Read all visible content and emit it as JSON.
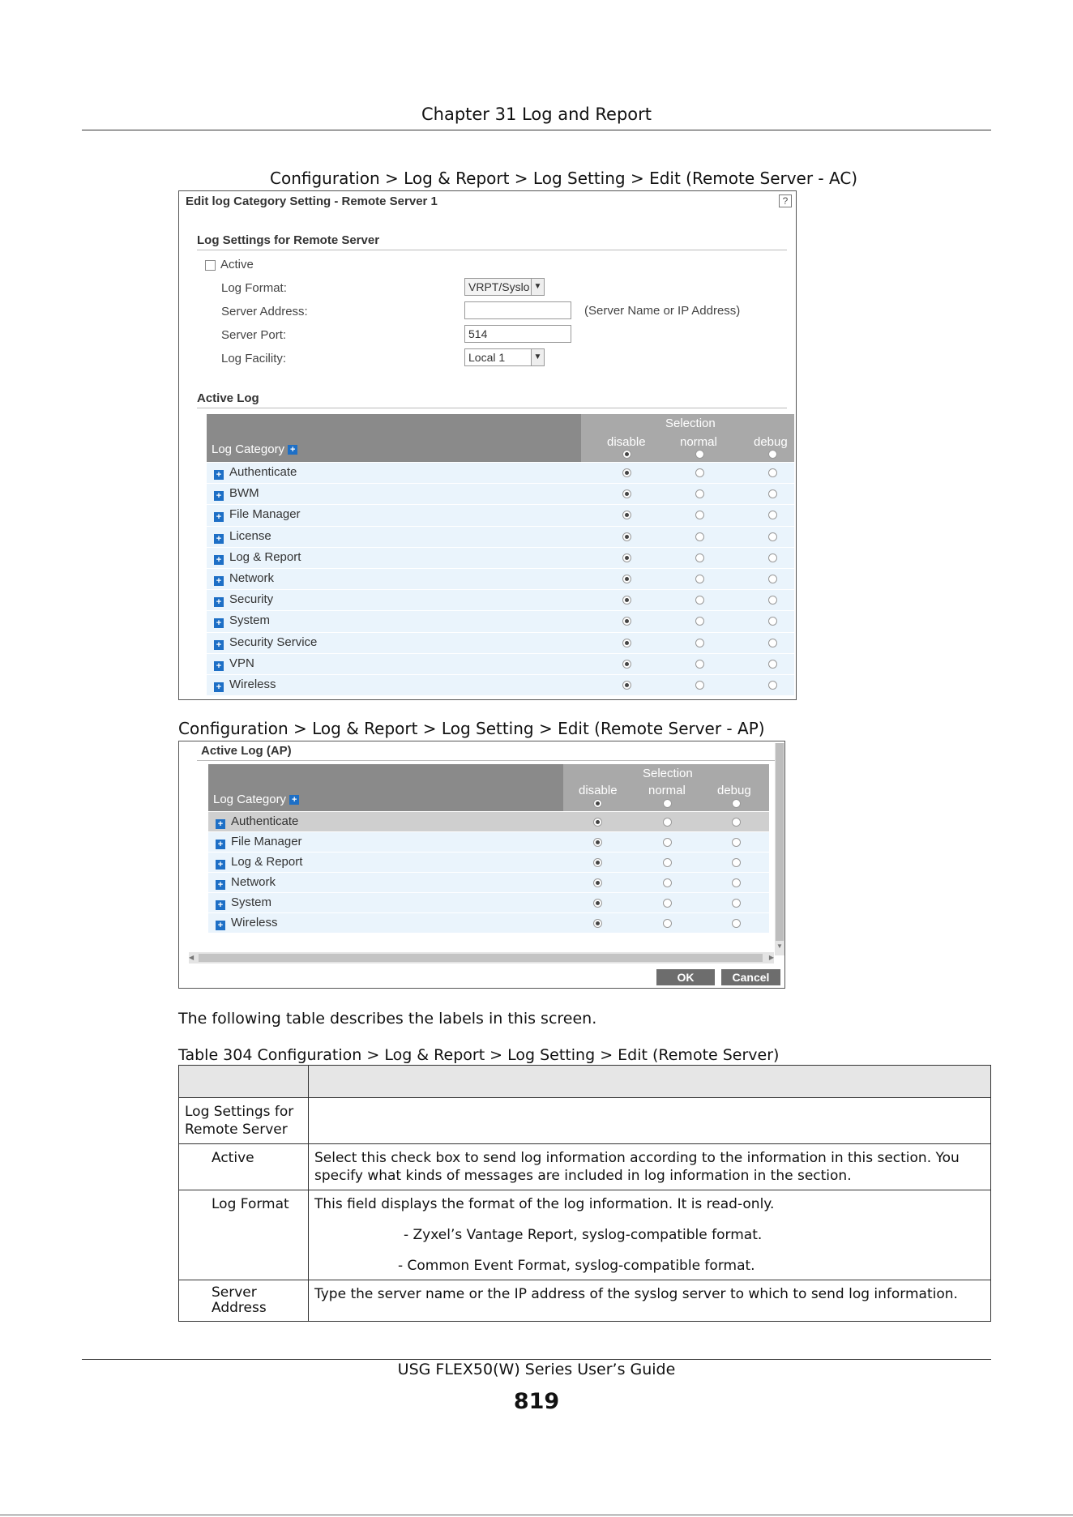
{
  "header": {
    "chapter": "Chapter 31 Log and Report"
  },
  "figure1": {
    "caption": "Configuration > Log & Report > Log Setting > Edit (Remote Server - AC)",
    "window_title": "Edit log Category Setting - Remote Server 1",
    "help_icon": "?",
    "section1_title": "Log Settings for Remote Server",
    "active_label": "Active",
    "log_format_label": "Log Format:",
    "log_format_value": "VRPT/Syslо",
    "server_address_label": "Server Address:",
    "server_address_value": "",
    "server_address_hint": "(Server Name or IP Address)",
    "server_port_label": "Server Port:",
    "server_port_value": "514",
    "log_facility_label": "Log Facility:",
    "log_facility_value": "Local 1",
    "section2_title": "Active Log",
    "col_category": "Log Category",
    "col_selection": "Selection",
    "col_disable": "disable",
    "col_normal": "normal",
    "col_debug": "debug",
    "rows": [
      {
        "label": "Authenticate",
        "selected": 0
      },
      {
        "label": "BWM",
        "selected": 0
      },
      {
        "label": "File Manager",
        "selected": 0
      },
      {
        "label": "License",
        "selected": 0
      },
      {
        "label": "Log & Report",
        "selected": 0
      },
      {
        "label": "Network",
        "selected": 0
      },
      {
        "label": "Security",
        "selected": 0
      },
      {
        "label": "System",
        "selected": 0
      },
      {
        "label": "Security Service",
        "selected": 0
      },
      {
        "label": "VPN",
        "selected": 0
      },
      {
        "label": "Wireless",
        "selected": 0
      }
    ]
  },
  "figure2": {
    "caption": "Configuration > Log & Report > Log Setting > Edit (Remote Server - AP)",
    "section_title": "Active Log (AP)",
    "col_category": "Log Category",
    "col_selection": "Selection",
    "col_disable": "disable",
    "col_normal": "normal",
    "col_debug": "debug",
    "rows": [
      {
        "label": "Authenticate",
        "selected": 0
      },
      {
        "label": "File Manager",
        "selected": 0
      },
      {
        "label": "Log & Report",
        "selected": 0
      },
      {
        "label": "Network",
        "selected": 0
      },
      {
        "label": "System",
        "selected": 0
      },
      {
        "label": "Wireless",
        "selected": 0
      }
    ],
    "ok_label": "OK",
    "cancel_label": "Cancel"
  },
  "description": "The following table describes the labels in this screen.",
  "table": {
    "caption": "Table 304   Configuration > Log & Report > Log Setting > Edit (Remote Server)",
    "r1_label": "Log Settings for Remote Server",
    "r2_label": "Active",
    "r2_desc": "Select this check box to send log information according to the information in this section. You specify what kinds of messages are included in log information in the section.",
    "r3_label": "Log Format",
    "r3_desc1": "This field displays the format of the log information. It is read-only.",
    "r3_desc2": "- Zyxel’s Vantage Report, syslog-compatible format.",
    "r3_desc3": "- Common Event Format, syslog-compatible format.",
    "r4_label": "Server Address",
    "r4_desc": "Type the server name or the IP address of the syslog server to which to send log information."
  },
  "footer": {
    "guide": "USG FLEX50(W) Series User’s Guide",
    "page_number": "819"
  }
}
